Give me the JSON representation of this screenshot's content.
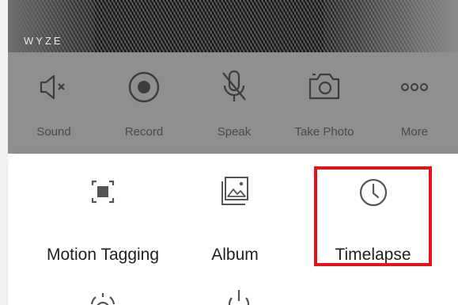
{
  "camera": {
    "logo": "WYZE"
  },
  "controls": [
    {
      "label": "Sound",
      "icon": "speaker-mute-icon"
    },
    {
      "label": "Record",
      "icon": "record-icon"
    },
    {
      "label": "Speak",
      "icon": "microphone-off-icon"
    },
    {
      "label": "Take Photo",
      "icon": "camera-icon"
    },
    {
      "label": "More",
      "icon": "more-dots-icon"
    }
  ],
  "sheet": {
    "items": [
      {
        "label": "Motion Tagging",
        "icon": "motion-tagging-icon"
      },
      {
        "label": "Album",
        "icon": "album-icon"
      },
      {
        "label": "Timelapse",
        "icon": "clock-icon"
      }
    ],
    "row2_icons": [
      "alarm-icon",
      "power-icon"
    ]
  },
  "highlight_color": "#e5121c"
}
